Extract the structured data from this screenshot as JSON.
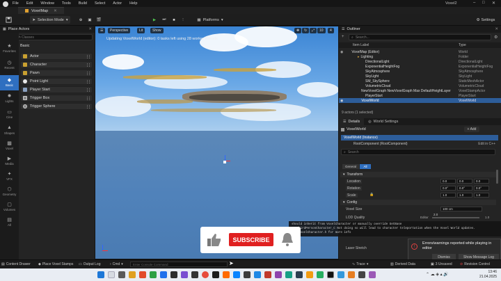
{
  "menubar": {
    "items": [
      "File",
      "Edit",
      "Window",
      "Tools",
      "Build",
      "Select",
      "Actor",
      "Help"
    ],
    "project": "Voxel2"
  },
  "tab": {
    "label": "VoxelMap"
  },
  "toolbar": {
    "selection_mode": "Selection Mode",
    "platforms": "Platforms",
    "settings": "Settings"
  },
  "place_actors": {
    "title": "Place Actors",
    "search_placeholder": "Search Classes",
    "group": "Basic",
    "items": [
      "Actor",
      "Character",
      "Pawn",
      "Point Light",
      "Player Start",
      "Trigger Box",
      "Trigger Sphere"
    ],
    "categories": [
      "Favorites",
      "Recent",
      "Basic",
      "Lights",
      "Cine",
      "Shapes",
      "Voxel",
      "Media",
      "VFX",
      "Geometry",
      "Volumes",
      "All"
    ]
  },
  "viewport": {
    "perspective": "Perspective",
    "lit": "Lit",
    "show": "Show",
    "status": "Updating VoxelWorld (editor): 0 tasks left using 28 worker threads",
    "grid": "10",
    "angle": "10°",
    "scale": "0.25",
    "cam": "4"
  },
  "outliner": {
    "title": "Outliner",
    "search_placeholder": "Search...",
    "col_label": "Item Label",
    "col_type": "Type",
    "rows": [
      {
        "name": "VoxelMap (Editor)",
        "type": "World"
      },
      {
        "name": "Lighting",
        "type": "Folder"
      },
      {
        "name": "DirectionalLight",
        "type": "DirectionalLight"
      },
      {
        "name": "ExponentialHeightFog",
        "type": "ExponentialHeightFog"
      },
      {
        "name": "SkyAtmosphere",
        "type": "SkyAtmosphere"
      },
      {
        "name": "SkyLight",
        "type": "SkyLight"
      },
      {
        "name": "SM_SkySphere",
        "type": "StaticMeshActor"
      },
      {
        "name": "VolumetricCloud",
        "type": "VolumetricCloud"
      },
      {
        "name": "NewVoxelGraph NewVoxelGraph Max DefaultHeightLayer",
        "type": "VoxelStampActor"
      },
      {
        "name": "PlayerStart",
        "type": "PlayerStart"
      },
      {
        "name": "VoxelWorld",
        "type": "VoxelWorld"
      }
    ],
    "count": "9 actors (1 selected)"
  },
  "details": {
    "tab1": "Details",
    "tab2": "World Settings",
    "actor": "VoxelWorld",
    "add": "+ Add",
    "instance": "VoxelWorld (Instance)",
    "root": "RootComponent (RootComponent)",
    "edit_cpp": "Edit in C++",
    "search_placeholder": "Search",
    "filter_general": "General",
    "filter_all": "All",
    "transform": "Transform",
    "location": "Location",
    "rotation": "Rotation",
    "scale": "Scale",
    "loc": [
      "0.0",
      "0.0",
      "0.0"
    ],
    "rot": [
      "0.0°",
      "0.0°",
      "0.0°"
    ],
    "scl": [
      "1.0",
      "1.0",
      "1.0"
    ],
    "config": "Config",
    "voxel_size": "Voxel Size",
    "voxel_size_val": "100 cm",
    "lod": "LOD Quality",
    "editor": "Editor",
    "lod_val": "2.0",
    "lod_max": "1.0",
    "laser": "Laser Stretch"
  },
  "log": {
    "lines": [
      "should inherit from VoxelCharacter or manually override GetBase",
      "BP_ThirdPersonCharacter_C Not doing so will lead to character teleportation when the Voxel World updates.",
      "See VoxelCharacter.h for more info"
    ]
  },
  "toast": {
    "title": "Errors/warnings reported while playing in editor",
    "dismiss": "Dismiss",
    "show_log": "Show Message Log"
  },
  "subscribe": {
    "label": "SUBSCRIBE"
  },
  "statusbar": {
    "content_drawer": "Content Drawer",
    "place_stamps": "Place Voxel Stamps",
    "output_log": "Output Log",
    "cmd": "Cmd",
    "cmd_placeholder": "Enter Console Command",
    "trace": "Trace",
    "derived": "Derived Data",
    "unsaved": "3 Unsaved",
    "revision": "Revision Control"
  },
  "taskbar": {
    "time": "13:46",
    "date": "21.04.2025"
  }
}
